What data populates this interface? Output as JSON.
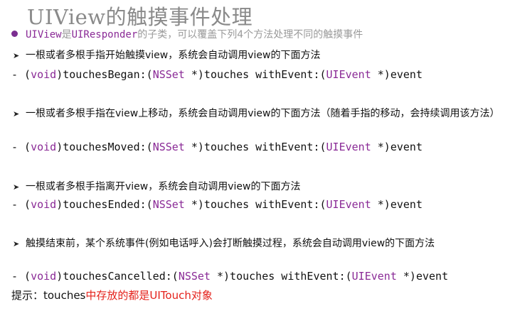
{
  "title": "UIView的触摸事件处理",
  "intro": {
    "kw1": "UIView",
    "t1": "是",
    "kw2": "UIResponder",
    "t2": "的子类，可以覆盖下列4个方法处理不同的触摸事件"
  },
  "items": [
    {
      "desc": "一根或者多根手指开始触摸view，系统会自动调用view的下面方法",
      "code": {
        "a": "- (",
        "void": "void",
        "b": ")touchesBegan:(",
        "nsset": "NSSet",
        "c": " *)touches withEvent:(",
        "uievent": "UIEvent",
        "d": " *)event"
      }
    },
    {
      "desc": "一根或者多根手指在view上移动，系统会自动调用view的下面方法（随着手指的移动，会持续调用该方法）",
      "code": {
        "a": "- (",
        "void": "void",
        "b": ")touchesMoved:(",
        "nsset": "NSSet",
        "c": " *)touches withEvent:(",
        "uievent": "UIEvent",
        "d": " *)event"
      }
    },
    {
      "desc": "一根或者多根手指离开view，系统会自动调用view的下面方法",
      "code": {
        "a": "- (",
        "void": "void",
        "b": ")touchesEnded:(",
        "nsset": "NSSet",
        "c": " *)touches withEvent:(",
        "uievent": "UIEvent",
        "d": " *)event"
      }
    },
    {
      "desc": "触摸结束前，某个系统事件(例如电话呼入)会打断触摸过程，系统会自动调用view的下面方法",
      "code": {
        "a": "- (",
        "void": "void",
        "b": ")touchesCancelled:(",
        "nsset": "NSSet",
        "c": " *)touches withEvent:(",
        "uievent": "UIEvent",
        "d": " *)event"
      }
    }
  ],
  "tip": {
    "prefix": "提示：touches",
    "red": "中存放的都是UITouch对象"
  }
}
